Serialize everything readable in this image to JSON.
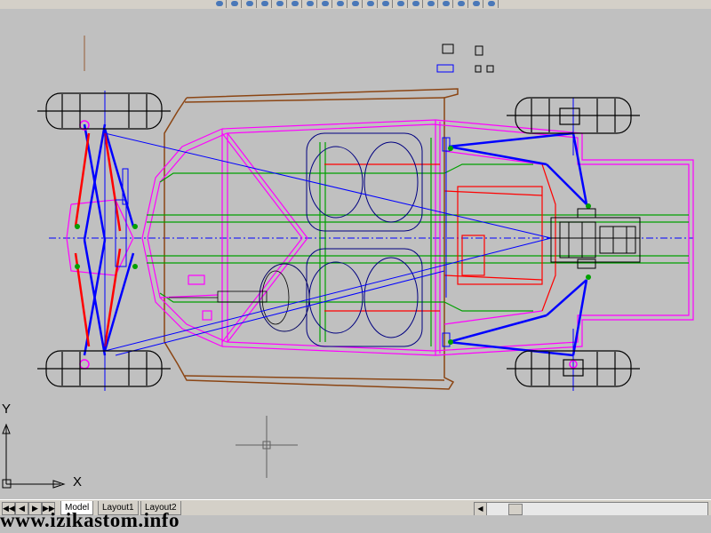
{
  "toolbar": {
    "tools": [
      "zoom-icon",
      "pan-icon",
      "layer-icon",
      "properties-icon",
      "match-icon",
      "distance-icon",
      "render-icon",
      "grid-icon",
      "snap-icon",
      "ortho-icon",
      "polar-icon",
      "osnap-icon",
      "otrack-icon",
      "lwt-icon",
      "model-icon",
      "print-icon",
      "preview-icon",
      "publish-icon",
      "help-icon"
    ]
  },
  "ucs": {
    "x_label": "X",
    "y_label": "Y"
  },
  "layout_tabs": [
    {
      "label": "Model",
      "active": true
    },
    {
      "label": "Layout1",
      "active": false
    },
    {
      "label": "Layout2",
      "active": false
    }
  ],
  "nav_buttons": [
    "◀◀",
    "◀",
    "▶",
    "▶▶"
  ],
  "watermark": "www.izikastom.info",
  "colors": {
    "background": "#c0c0c0",
    "frame_magenta": "#ff00ff",
    "suspension_blue": "#0000ff",
    "arm_red": "#ff0000",
    "rail_green": "#00a000",
    "body_brown": "#8b4513",
    "wheel_black": "#000000"
  }
}
